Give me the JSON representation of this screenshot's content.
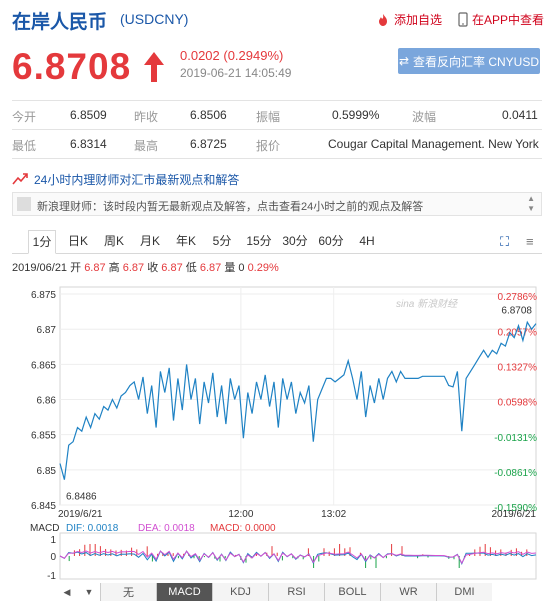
{
  "header": {
    "title": "在岸人民币",
    "code": "(USDCNY)",
    "fav_label": "添加自选",
    "app_label": "在APP中查看"
  },
  "quote_head": {
    "price": "6.8708",
    "change": "0.0202 (0.2949%)",
    "timestamp": "2019-06-21 14:05:49",
    "reverse_label": "查看反向汇率 CNYUSD"
  },
  "stats": {
    "open_label": "今开",
    "open": "6.8509",
    "prev_label": "昨收",
    "prev": "6.8506",
    "amp_label": "振幅",
    "amp": "0.5999%",
    "wave_label": "波幅",
    "wave": "0.0411",
    "low_label": "最低",
    "low": "6.8314",
    "high_label": "最高",
    "high": "6.8725",
    "quoter_label": "报价",
    "quoter": "Cougar Capital Management. New York"
  },
  "news": {
    "head": "24小时内理财师对汇市最新观点和解答",
    "body": "新浪理财师：该时段内暂无最新观点及解答，点击查看24小时之前的观点及解答"
  },
  "tabs": [
    "1分",
    "日K",
    "周K",
    "月K",
    "年K",
    "5分",
    "15分",
    "30分",
    "60分",
    "4H"
  ],
  "quote_line": {
    "date": "2019/06/21",
    "open_label": "开",
    "open": "6.87",
    "high_label": "高",
    "high": "6.87",
    "close_label": "收",
    "close": "6.87",
    "low_label": "低",
    "low": "6.87",
    "vol_label": "量",
    "vol": "0",
    "pct": "0.29%"
  },
  "watermark": "sina 新浪财经",
  "indicators": [
    "无",
    "MACD",
    "KDJ",
    "RSI",
    "BOLL",
    "WR",
    "DMI"
  ],
  "colors": {
    "up": "#e4393c",
    "down": "#1aa34a",
    "line": "#1f82c4",
    "brand": "#1a57a8"
  },
  "chart_data": {
    "type": "line",
    "ylim": [
      6.845,
      6.876
    ],
    "yticks": [
      "6.875",
      "6.87",
      "6.865",
      "6.86",
      "6.855",
      "6.85",
      "6.845"
    ],
    "pct_ticks": [
      {
        "label": "0.2786%",
        "v": 6.8747,
        "dir": "up"
      },
      {
        "label": "0.2057%",
        "v": 6.8697,
        "dir": "up"
      },
      {
        "label": "0.1327%",
        "v": 6.8647,
        "dir": "up"
      },
      {
        "label": "0.0598%",
        "v": 6.8597,
        "dir": "up"
      },
      {
        "label": "-0.0131%",
        "v": 6.8547,
        "dir": "down"
      },
      {
        "label": "-0.0861%",
        "v": 6.8497,
        "dir": "down"
      },
      {
        "label": "-0.1590%",
        "v": 6.8447,
        "dir": "down"
      }
    ],
    "xticks": [
      {
        "label": "2019/6/21",
        "t": 0
      },
      {
        "label": "12:00",
        "t": 0.38
      },
      {
        "label": "13:02",
        "t": 0.575
      },
      {
        "label": "2019/6/21",
        "t": 1
      }
    ],
    "last_value": "6.8708",
    "min_value": "6.8486",
    "series": [
      6.8509,
      6.8486,
      6.8535,
      6.854,
      6.856,
      6.8555,
      6.8575,
      6.856,
      6.858,
      6.8572,
      6.859,
      6.8585,
      6.86,
      6.8588,
      6.8605,
      6.861,
      6.862,
      6.8625,
      6.86,
      6.8632,
      6.858,
      6.862,
      6.856,
      6.864,
      6.861,
      6.8645,
      6.857,
      6.863,
      6.8585,
      6.865,
      6.86,
      6.863,
      6.8565,
      6.8625,
      6.8595,
      6.8638,
      6.8575,
      6.862,
      6.8565,
      6.863,
      6.86,
      6.862,
      6.8545,
      6.861,
      6.858,
      6.8625,
      6.86,
      6.8635,
      6.859,
      6.8625,
      6.856,
      6.863,
      6.86,
      6.8625,
      6.858,
      6.861,
      6.8595,
      6.862,
      6.854,
      6.86,
      6.8615,
      6.863,
      6.863,
      6.8625,
      6.863,
      6.8635,
      6.8655,
      6.863,
      6.86,
      6.864,
      6.8575,
      6.862,
      6.8595,
      6.863,
      6.86,
      6.863,
      6.864,
      6.8625,
      6.864,
      6.863,
      6.863,
      6.863,
      6.863,
      6.8633,
      6.8633,
      6.8633,
      6.8633,
      6.8633,
      6.8633,
      6.862,
      6.8618,
      6.864,
      6.8555,
      6.863,
      6.864,
      6.865,
      6.866,
      6.867,
      6.866,
      6.867,
      6.8665,
      6.868,
      6.8676,
      6.8695,
      6.8688,
      6.8705,
      6.8684,
      6.871,
      6.87,
      6.8708
    ],
    "macd": {
      "dif_label": "MACD",
      "dif_name": "DIF:",
      "dif": "0.0018",
      "dea_name": "DEA:",
      "dea": "0.0018",
      "macd_name": "MACD:",
      "macd": "0.0000",
      "yticks": [
        "1",
        "0",
        "-1"
      ]
    }
  }
}
